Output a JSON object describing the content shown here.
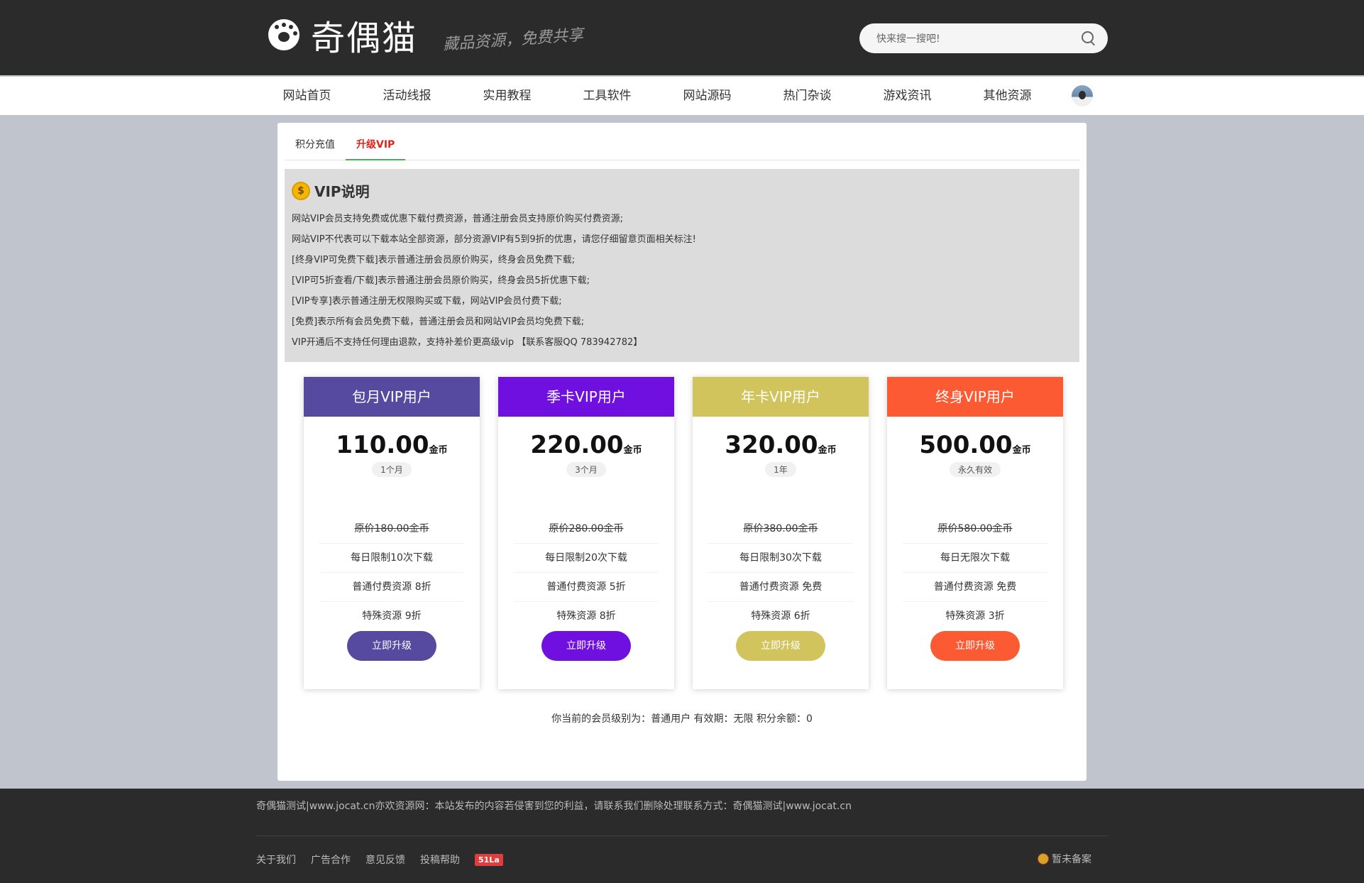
{
  "header": {
    "logo_name": "奇偶猫",
    "slogan": "藏品资源，免费共享",
    "search_placeholder": "快来搜一搜吧!"
  },
  "nav": {
    "items": [
      "网站首页",
      "活动线报",
      "实用教程",
      "工具软件",
      "网站源码",
      "热门杂谈",
      "游戏资讯",
      "其他资源"
    ]
  },
  "tabs": [
    "积分充值",
    "升级VIP"
  ],
  "notice": {
    "title": "VIP说明",
    "lines": [
      "网站VIP会员支持免费或优惠下载付费资源，普通注册会员支持原价购买付费资源;",
      "网站VIP不代表可以下载本站全部资源，部分资源VIP有5到9折的优惠，请您仔细留意页面相关标注!",
      "[终身VIP可免费下载]表示普通注册会员原价购买，终身会员免费下载;",
      "[VIP可5折查看/下载]表示普通注册会员原价购买，终身会员5折优惠下载;",
      "[VIP专享]表示普通注册无权限购买或下载，网站VIP会员付费下载;",
      "[免费]表示所有会员免费下载，普通注册会员和网站VIP会员均免费下载;",
      "VIP开通后不支持任何理由退款，支持补差价更高级vip 【联系客服QQ 783942782】"
    ]
  },
  "plans": [
    {
      "name": "包月VIP用户",
      "price": "110.00",
      "unit": "金币",
      "period": "1个月",
      "original": "原价180.00金币",
      "daily": "每日限制10次下载",
      "normal": "普通付费资源 8折",
      "special": "特殊资源 9折",
      "button": "立即升级",
      "color": "#5549a0"
    },
    {
      "name": "季卡VIP用户",
      "price": "220.00",
      "unit": "金币",
      "period": "3个月",
      "original": "原价280.00金币",
      "daily": "每日限制20次下载",
      "normal": "普通付费资源 5折",
      "special": "特殊资源 8折",
      "button": "立即升级",
      "color": "#6f10e0"
    },
    {
      "name": "年卡VIP用户",
      "price": "320.00",
      "unit": "金币",
      "period": "1年",
      "original": "原价380.00金币",
      "daily": "每日限制30次下载",
      "normal": "普通付费资源 免费",
      "special": "特殊资源 6折",
      "button": "立即升级",
      "color": "#d1c45c"
    },
    {
      "name": "终身VIP用户",
      "price": "500.00",
      "unit": "金币",
      "period": "永久有效",
      "original": "原价580.00金币",
      "daily": "每日无限次下载",
      "normal": "普通付费资源 免费",
      "special": "特殊资源 3折",
      "button": "立即升级",
      "color": "#fc5a33"
    }
  ],
  "status": "你当前的会员级别为：普通用户 有效期：无限 积分余额：0",
  "footer": {
    "text": "奇偶猫测试|www.jocat.cn亦欢资源网：本站发布的内容若侵害到您的利益，请联系我们删除处理联系方式：奇偶猫测试|www.jocat.cn",
    "links": [
      "关于我们",
      "广告合作",
      "意见反馈",
      "投稿帮助"
    ],
    "badge": "51La",
    "beian": "暂未备案"
  }
}
